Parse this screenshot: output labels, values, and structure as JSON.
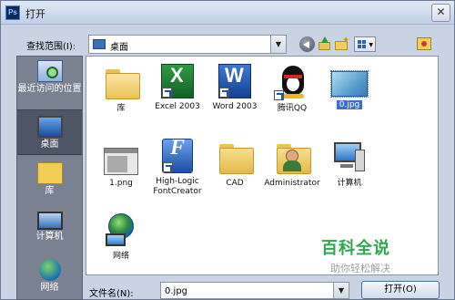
{
  "window": {
    "app_icon_text": "Ps",
    "title": "打开",
    "close_glyph": "✕"
  },
  "toolbar": {
    "look_in_label": "查找范围(I):",
    "look_in_value": "桌面",
    "dropdown_glyph": "▼",
    "view_caret": "▼",
    "icons": [
      "back-icon",
      "up-folder-icon",
      "new-folder-icon",
      "view-menu-icon",
      "favorites-icon"
    ]
  },
  "places": [
    {
      "label": "最近访问的位置",
      "icon": "recent-places-icon"
    },
    {
      "label": "桌面",
      "icon": "desktop-icon",
      "active": true
    },
    {
      "label": "库",
      "icon": "libraries-icon"
    },
    {
      "label": "计算机",
      "icon": "computer-icon"
    },
    {
      "label": "网络",
      "icon": "network-icon"
    }
  ],
  "files": [
    {
      "label": "库",
      "icon": "libraries-folder-icon"
    },
    {
      "label": "Excel 2003",
      "icon": "excel-icon",
      "shortcut": true
    },
    {
      "label": "Word 2003",
      "icon": "word-icon",
      "shortcut": true
    },
    {
      "label": "腾讯QQ",
      "icon": "qq-icon",
      "shortcut": true
    },
    {
      "label": "0.jpg",
      "icon": "image-file-icon",
      "selected": true
    },
    {
      "label": "1.png",
      "icon": "png-file-icon"
    },
    {
      "label": "High-Logic FontCreator",
      "icon": "fontcreator-icon",
      "shortcut": true
    },
    {
      "label": "CAD",
      "icon": "folder-icon"
    },
    {
      "label": "Administrator",
      "icon": "user-folder-icon"
    },
    {
      "label": "计算机",
      "icon": "computer-icon"
    },
    {
      "label": "网络",
      "icon": "network-icon"
    }
  ],
  "watermark": {
    "main": "百科全说",
    "sub": "助你轻松解决"
  },
  "footer": {
    "filename_label": "文件名(N):",
    "filename_value": "0.jpg",
    "dropdown_glyph": "▼",
    "open_button": "打开(O)"
  }
}
